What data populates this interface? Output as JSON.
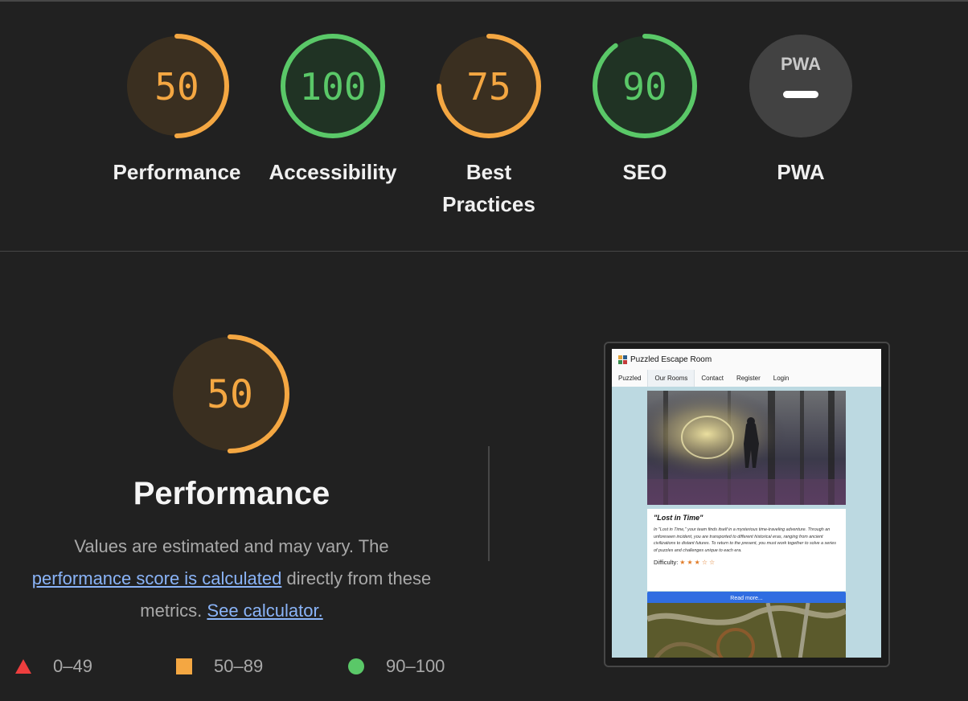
{
  "categories": [
    {
      "label": "Performance",
      "score": 50,
      "status": "average",
      "color": "#f4a742"
    },
    {
      "label": "Accessibility",
      "score": 100,
      "status": "pass",
      "color": "#5ac868"
    },
    {
      "label": "Best Practices",
      "score": 75,
      "status": "average",
      "color": "#f4a742"
    },
    {
      "label": "SEO",
      "score": 90,
      "status": "pass",
      "color": "#5ac868"
    },
    {
      "label": "PWA",
      "score": null,
      "badge_text": "PWA",
      "status": "not-applicable",
      "color": "#e6e6e6"
    }
  ],
  "performance": {
    "score": 50,
    "title": "Performance",
    "description_prefix": "Values are estimated and may vary. The",
    "score_link": "performance score is calculated",
    "description_mid": "directly from these metrics.",
    "calculator_link": "See calculator."
  },
  "legend": [
    {
      "range": "0–49",
      "shape": "triangle",
      "color": "#ee3e3e"
    },
    {
      "range": "50–89",
      "shape": "square",
      "color": "#f4a742"
    },
    {
      "range": "90–100",
      "shape": "circle",
      "color": "#5ac868"
    }
  ],
  "screenshot": {
    "site_title": "Puzzled Escape Room",
    "nav": [
      "Puzzled",
      "Our Rooms",
      "Contact",
      "Register",
      "Login"
    ],
    "active_nav": "Our Rooms",
    "room_title": "\"Lost in Time\"",
    "room_text": "In \"Lost in Time,\" your team finds itself in a mysterious time-traveling adventure. Through an unforeseen incident, you are transported to different historical eras, ranging from ancient civilizations to distant futures. To return to the present, you must work together to solve a series of puzzles and challenges unique to each era.",
    "difficulty_label": "Difficulty:",
    "difficulty_rating": 3,
    "difficulty_max": 5,
    "button_label": "Read more..."
  }
}
